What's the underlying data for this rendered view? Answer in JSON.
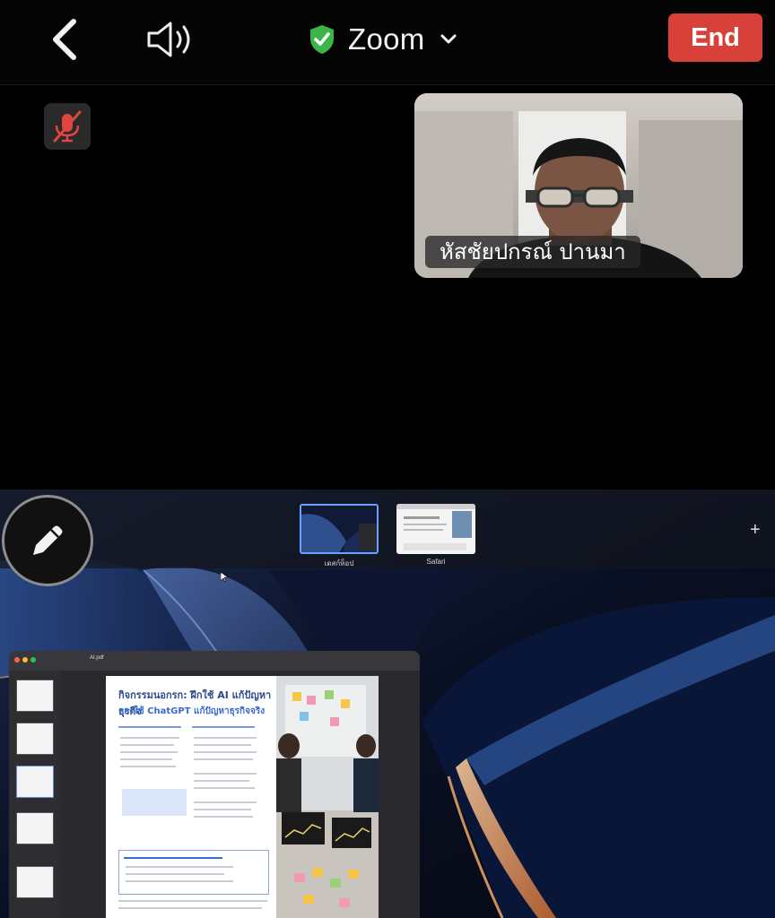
{
  "header": {
    "back_icon": "chevron-left-icon",
    "speaker_icon": "speaker-icon",
    "security_icon": "shield-check-icon",
    "security_color": "#3bb54a",
    "title": "Zoom",
    "title_dropdown_icon": "chevron-down-icon",
    "end_label": "End",
    "end_color": "#d8413a"
  },
  "self_view": {
    "mic_status_icon": "mic-muted-icon"
  },
  "video": {
    "participant_name": "หัสชัยปกรณ์ ปานมา"
  },
  "screen_share": {
    "annotate_icon": "pencil-icon",
    "mission_control": {
      "spaces": [
        {
          "label": "เดสก์ท็อป"
        },
        {
          "label": "Safari"
        }
      ],
      "add_icon": "plus-icon"
    },
    "preview_window": {
      "title": "AI.pdf",
      "page_heading": "กิจกรรมนอกรก: ฝึกใช้ AI แก้ปัญหาธุรกิจ",
      "page_subheading": "ลองใช้ ChatGPT แก้ปัญหาธุรกิจจริง"
    }
  }
}
